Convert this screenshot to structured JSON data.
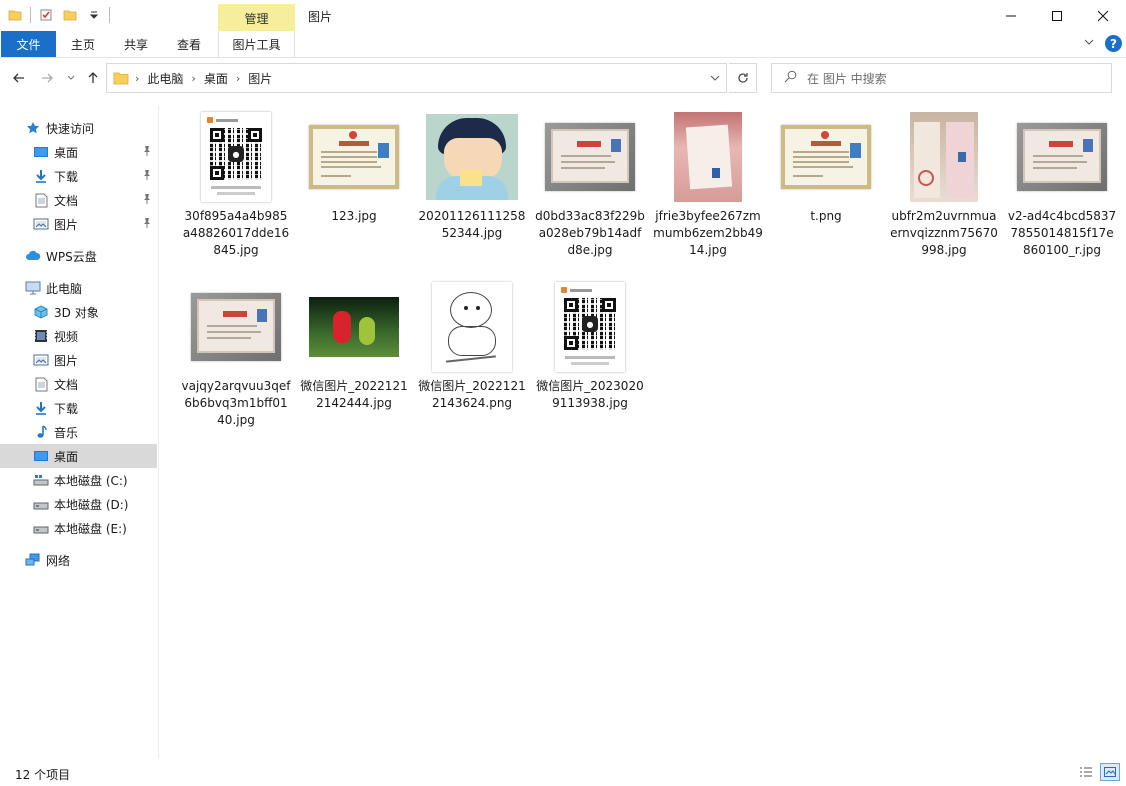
{
  "window": {
    "title": "图片",
    "manage_tab": "管理"
  },
  "ribbon": {
    "tabs": [
      "文件",
      "主页",
      "共享",
      "查看",
      "图片工具"
    ]
  },
  "address": {
    "crumbs": [
      "此电脑",
      "桌面",
      "图片"
    ],
    "search_placeholder": "在 图片 中搜索"
  },
  "sidebar": {
    "items": [
      {
        "label": "快速访问",
        "icon": "star-icon",
        "pinned": false
      },
      {
        "label": "桌面",
        "icon": "desktop-icon",
        "pinned": true
      },
      {
        "label": "下载",
        "icon": "download-icon",
        "pinned": true
      },
      {
        "label": "文档",
        "icon": "document-icon",
        "pinned": true
      },
      {
        "label": "图片",
        "icon": "pictures-icon",
        "pinned": true
      },
      {
        "label": "WPS云盘",
        "icon": "cloud-icon",
        "pinned": false
      },
      {
        "label": "此电脑",
        "icon": "computer-icon",
        "pinned": false
      },
      {
        "label": "3D 对象",
        "icon": "3d-objects-icon",
        "pinned": false
      },
      {
        "label": "视频",
        "icon": "video-icon",
        "pinned": false
      },
      {
        "label": "图片",
        "icon": "pictures-icon",
        "pinned": false
      },
      {
        "label": "文档",
        "icon": "document-icon",
        "pinned": false
      },
      {
        "label": "下载",
        "icon": "download-icon",
        "pinned": false
      },
      {
        "label": "音乐",
        "icon": "music-icon",
        "pinned": false
      },
      {
        "label": "桌面",
        "icon": "desktop-icon",
        "pinned": false,
        "selected": true
      },
      {
        "label": "本地磁盘 (C:)",
        "icon": "drive-c-icon",
        "pinned": false
      },
      {
        "label": "本地磁盘 (D:)",
        "icon": "drive-icon",
        "pinned": false
      },
      {
        "label": "本地磁盘 (E:)",
        "icon": "drive-icon",
        "pinned": false
      },
      {
        "label": "网络",
        "icon": "network-icon",
        "pinned": false
      }
    ]
  },
  "files": [
    {
      "name": "30f895a4a4b985a48826017dde16845.jpg",
      "thumb": "qr"
    },
    {
      "name": "123.jpg",
      "thumb": "certificate"
    },
    {
      "name": "2020112611125852344.jpg",
      "thumb": "cartoon"
    },
    {
      "name": "d0bd33ac83f229ba028eb79b14adfd8e.jpg",
      "thumb": "certificate-photo"
    },
    {
      "name": "jfrie3byfee267zmmumb6zem2bb4914.jpg",
      "thumb": "id-book"
    },
    {
      "name": "t.png",
      "thumb": "certificate"
    },
    {
      "name": "ubfr2m2uvrnmuaernvqizznm75670998.jpg",
      "thumb": "document-photo"
    },
    {
      "name": "v2-ad4c4bcd58377855014815f17e860100_r.jpg",
      "thumb": "certificate-photo"
    },
    {
      "name": "vajqy2arqvuu3qef6b6bvq3m1bff0140.jpg",
      "thumb": "certificate-photo"
    },
    {
      "name": "微信图片_20221212142444.jpg",
      "thumb": "teletubbies"
    },
    {
      "name": "微信图片_20221212143624.png",
      "thumb": "dog-sketch"
    },
    {
      "name": "微信图片_20230209113938.jpg",
      "thumb": "qr"
    }
  ],
  "status": {
    "count_text": "12 个项目"
  },
  "colors": {
    "accent": "#1a6fc8",
    "manage_tab": "#f6ee9c",
    "selected_nav": "#d9d9d9"
  }
}
